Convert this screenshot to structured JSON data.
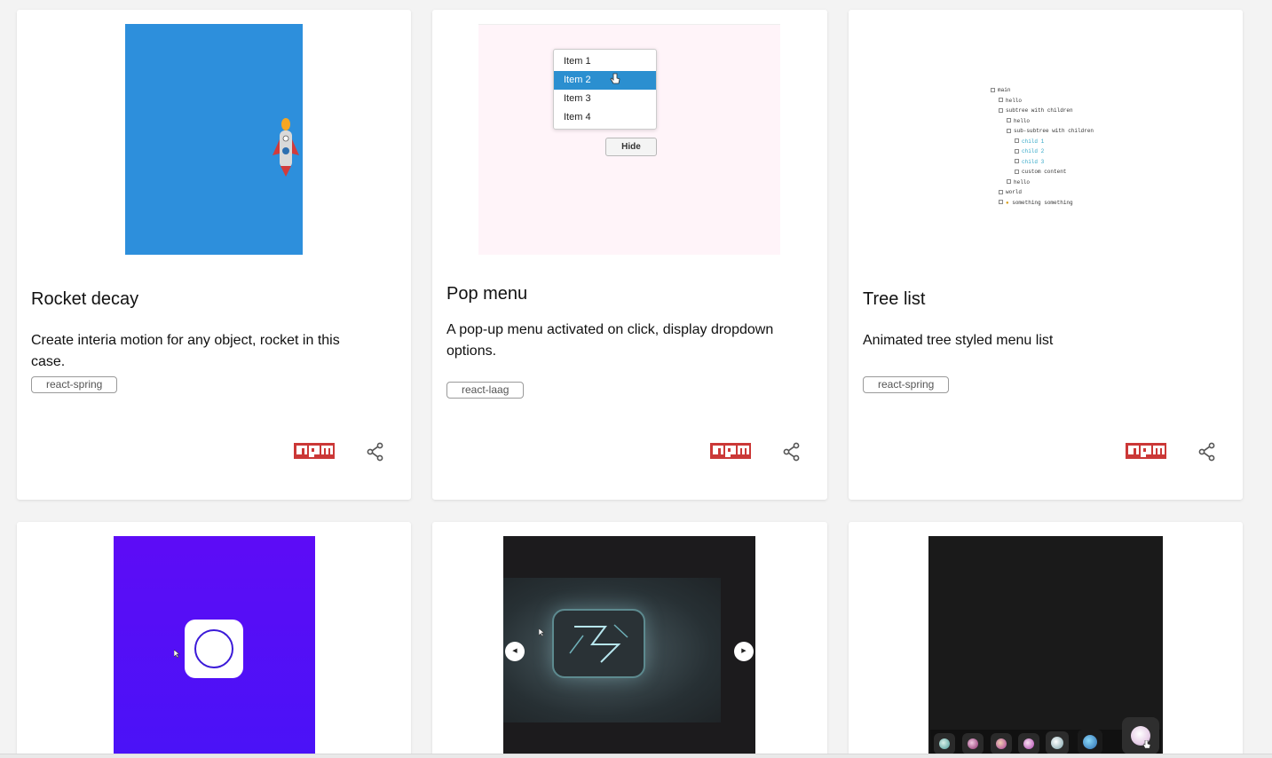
{
  "cards": [
    {
      "title": "Rocket decay",
      "description": "Create interia motion for any object, rocket in this case.",
      "tag": "react-spring",
      "preview_bg": "#2d8fdc"
    },
    {
      "title": "Pop menu",
      "description": "A pop-up menu activated on click, display dropdown options.",
      "tag": "react-laag",
      "preview_bg": "#fff4f9",
      "menu_items": [
        "Item 1",
        "Item 2",
        "Item 3",
        "Item 4"
      ],
      "selected_item": "Item 2",
      "hide_label": "Hide"
    },
    {
      "title": "Tree list",
      "description": "Animated tree styled menu list",
      "tag": "react-spring",
      "tree": [
        "main",
        "hello",
        "subtree with children",
        "hello",
        "sub-subtree with children",
        "child 1",
        "child 2",
        "child 3",
        "custom content",
        "hello",
        "world",
        "something something"
      ]
    },
    {
      "preview_bg": "#5a0cf5"
    },
    {
      "preview_bg": "#1c1b1d"
    },
    {
      "preview_bg": "#1a1a1a"
    }
  ],
  "icons": {
    "npm": "npm-icon",
    "share": "share-icon"
  },
  "colors": {
    "npm_red": "#cb3837",
    "share_gray": "#555555"
  }
}
